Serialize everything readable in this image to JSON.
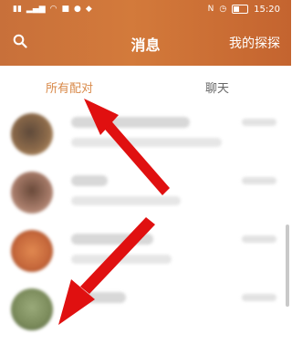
{
  "status_bar": {
    "time": "15:20",
    "left_icon_names": [
      "sim-signal-icon",
      "signal-icon",
      "wifi-icon",
      "app-icon",
      "message-icon",
      "notification-icon"
    ],
    "right_icon_names": [
      "nfc-icon",
      "alarm-icon",
      "battery-icon"
    ]
  },
  "header": {
    "title": "消息",
    "right_action": "我的探探",
    "search_icon": "search-icon",
    "background_color": "#c8703a"
  },
  "tabs": [
    {
      "label": "所有配对",
      "active": true,
      "color": "#d98a4a"
    },
    {
      "label": "聊天",
      "active": false,
      "color": "#666666"
    }
  ],
  "list": {
    "rows": [
      {
        "avatar_color": "#8c6a4a",
        "avatar_badge": "#f0d070"
      },
      {
        "avatar_color": "#a87c6a",
        "avatar_badge": ""
      },
      {
        "avatar_color": "#c4663a",
        "avatar_badge": ""
      },
      {
        "avatar_color": "#7a8a5a",
        "avatar_badge": ""
      }
    ]
  },
  "annotation": {
    "arrow_color": "#e01010"
  }
}
